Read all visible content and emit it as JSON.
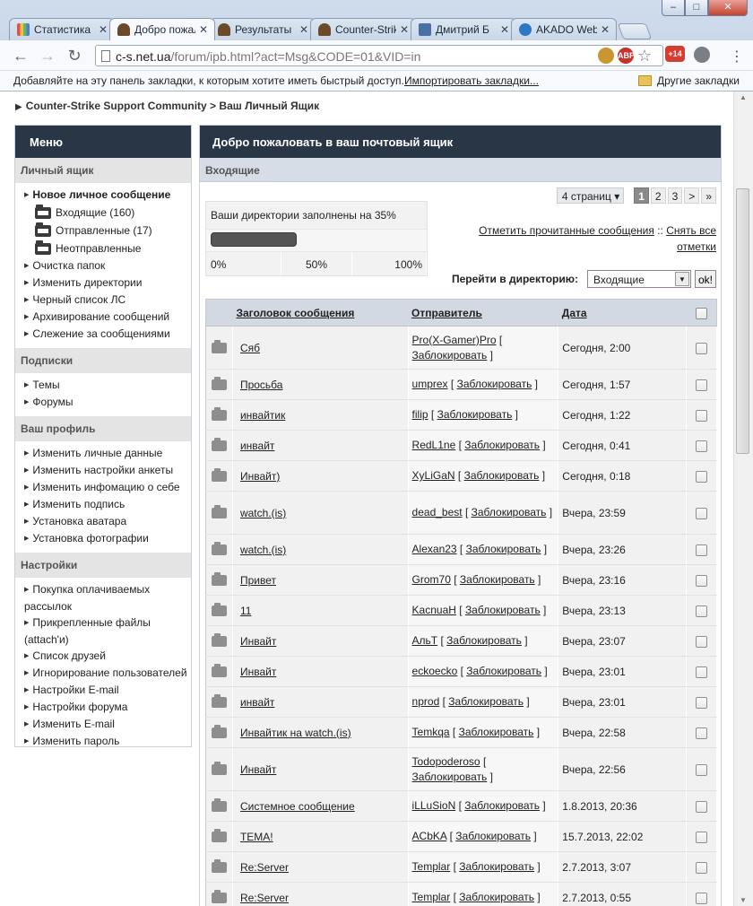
{
  "window": {
    "minimize": "–",
    "maximize": "□",
    "close": "✕"
  },
  "tabs": [
    {
      "title": "Статистика",
      "icon_color": "#e2514a"
    },
    {
      "title": "Добро пожаловать",
      "icon_color": "#6b4a2a"
    },
    {
      "title": "Результаты",
      "icon_color": "#6b4a2a"
    },
    {
      "title": "Counter-Strike",
      "icon_color": "#6b4a2a"
    },
    {
      "title": "Дмитрий Б",
      "icon_color": "#4a6fa5"
    },
    {
      "title": "AKADO Web",
      "icon_color": "#2b78c5"
    }
  ],
  "toolbar": {
    "url_host": "c-s.net.ua",
    "url_path": "/forum/ipb.html?act=Msg&CODE=01&VID=in",
    "abp_label": "ABP",
    "badge_label": "+14"
  },
  "bookmarks": {
    "hint": "Добавляйте на эту панель закладки, к которым хотите иметь быстрый доступ.",
    "import": "Импортировать закладки...",
    "other": "Другие закладки"
  },
  "breadcrumb": {
    "community": "Counter-Strike Support Community",
    "sep": " > ",
    "current": "Ваш Личный Ящик"
  },
  "sidebar": {
    "title": "Меню",
    "sections": {
      "inbox": "Личный ящик",
      "subs": "Подписки",
      "profile": "Ваш профиль",
      "settings": "Настройки"
    },
    "new_message": "Новое личное сообщение",
    "folders": [
      "Входящие (160)",
      "Отправленные (17)",
      "Неотправленные"
    ],
    "inbox_links": [
      "Очистка папок",
      "Изменить директории",
      "Черный список ЛС",
      "Архивирование сообщений",
      "Слежение за сообщениями"
    ],
    "sub_links": [
      "Темы",
      "Форумы"
    ],
    "profile_links": [
      "Изменить личные данные",
      "Изменить настройки анкеты",
      "Изменить инфомацию о себе",
      "Изменить подпись",
      "Установка аватара",
      "Установка фотографии"
    ],
    "settings_links": [
      "Покупка оплачиваемых рассылок",
      "Прикрепленные файлы (attach'и)",
      "Список друзей",
      "Игнорирование пользователей",
      "Настройки E-mail",
      "Настройки форума",
      "Изменить E-mail",
      "Изменить пароль"
    ]
  },
  "main": {
    "title": "Добро пожаловать в ваш почтовый ящик",
    "folder": "Входящие",
    "quota": {
      "text": "Ваши директории заполнены на 35%",
      "fill_percent": 35,
      "scale": [
        "0%",
        "50%",
        "100%"
      ]
    },
    "pager": {
      "count": "4 страниц ▾",
      "pages": [
        "1",
        "2",
        "3",
        ">",
        "»"
      ],
      "current": "1"
    },
    "mark_read": "Отметить прочитанные сообщения",
    "mark_sep": " :: ",
    "remove_all": "Снять все отметки",
    "goto_label": "Перейти в директорию:",
    "goto_value": "Входящие",
    "ok": "ok!",
    "columns": {
      "subject": "Заголовок сообщения",
      "sender": "Отправитель",
      "date": "Дата"
    },
    "block_label": "Заблокировать",
    "messages": [
      {
        "subject": "Сяб",
        "sender": "Pro(X-Gamer)Pro",
        "date": "Сегодня, 2:00",
        "tall": true
      },
      {
        "subject": "Просьба",
        "sender": "umprex",
        "date": "Сегодня, 1:57",
        "tall": false
      },
      {
        "subject": "инвайтик",
        "sender": "filip",
        "date": "Сегодня, 1:22",
        "tall": false
      },
      {
        "subject": "инвайт",
        "sender": "RedL1ne",
        "date": "Сегодня, 0:41",
        "tall": false
      },
      {
        "subject": "Инвайт)",
        "sender": "XyLiGaN",
        "date": "Сегодня, 0:18",
        "tall": false
      },
      {
        "subject": "watch.(is)",
        "sender": "dead_best",
        "date": "Вчера, 23:59",
        "tall": true
      },
      {
        "subject": "watch.(is)",
        "sender": "Alexan23",
        "date": "Вчера, 23:26",
        "tall": false
      },
      {
        "subject": "Привет",
        "sender": "Grom70",
        "date": "Вчера, 23:16",
        "tall": false
      },
      {
        "subject": "11",
        "sender": "KacnuaH",
        "date": "Вчера, 23:13",
        "tall": false
      },
      {
        "subject": "Инвайт",
        "sender": "АльТ",
        "date": "Вчера, 23:07",
        "tall": false
      },
      {
        "subject": "Инвайт",
        "sender": "eckoecko",
        "date": "Вчера, 23:01",
        "tall": false
      },
      {
        "subject": "инвайт",
        "sender": "nprod",
        "date": "Вчера, 23:01",
        "tall": false
      },
      {
        "subject": "Инвайтик на watch.(is)",
        "sender": "Temkqa",
        "date": "Вчера, 22:58",
        "tall": false
      },
      {
        "subject": "Инвайт",
        "sender": "Todopoderoso",
        "date": "Вчера, 22:56",
        "tall": true
      },
      {
        "subject": "Системное сообщение",
        "sender": "iLLuSioN",
        "date": "1.8.2013, 20:36",
        "tall": false
      },
      {
        "subject": "ТЕМА!",
        "sender": "ACbKA",
        "date": "15.7.2013, 22:02",
        "tall": false
      },
      {
        "subject": "Re:Server",
        "sender": "Templar",
        "date": "2.7.2013, 3:07",
        "tall": false
      },
      {
        "subject": "Re:Server",
        "sender": "Templar",
        "date": "2.7.2013, 0:55",
        "tall": false
      }
    ]
  }
}
